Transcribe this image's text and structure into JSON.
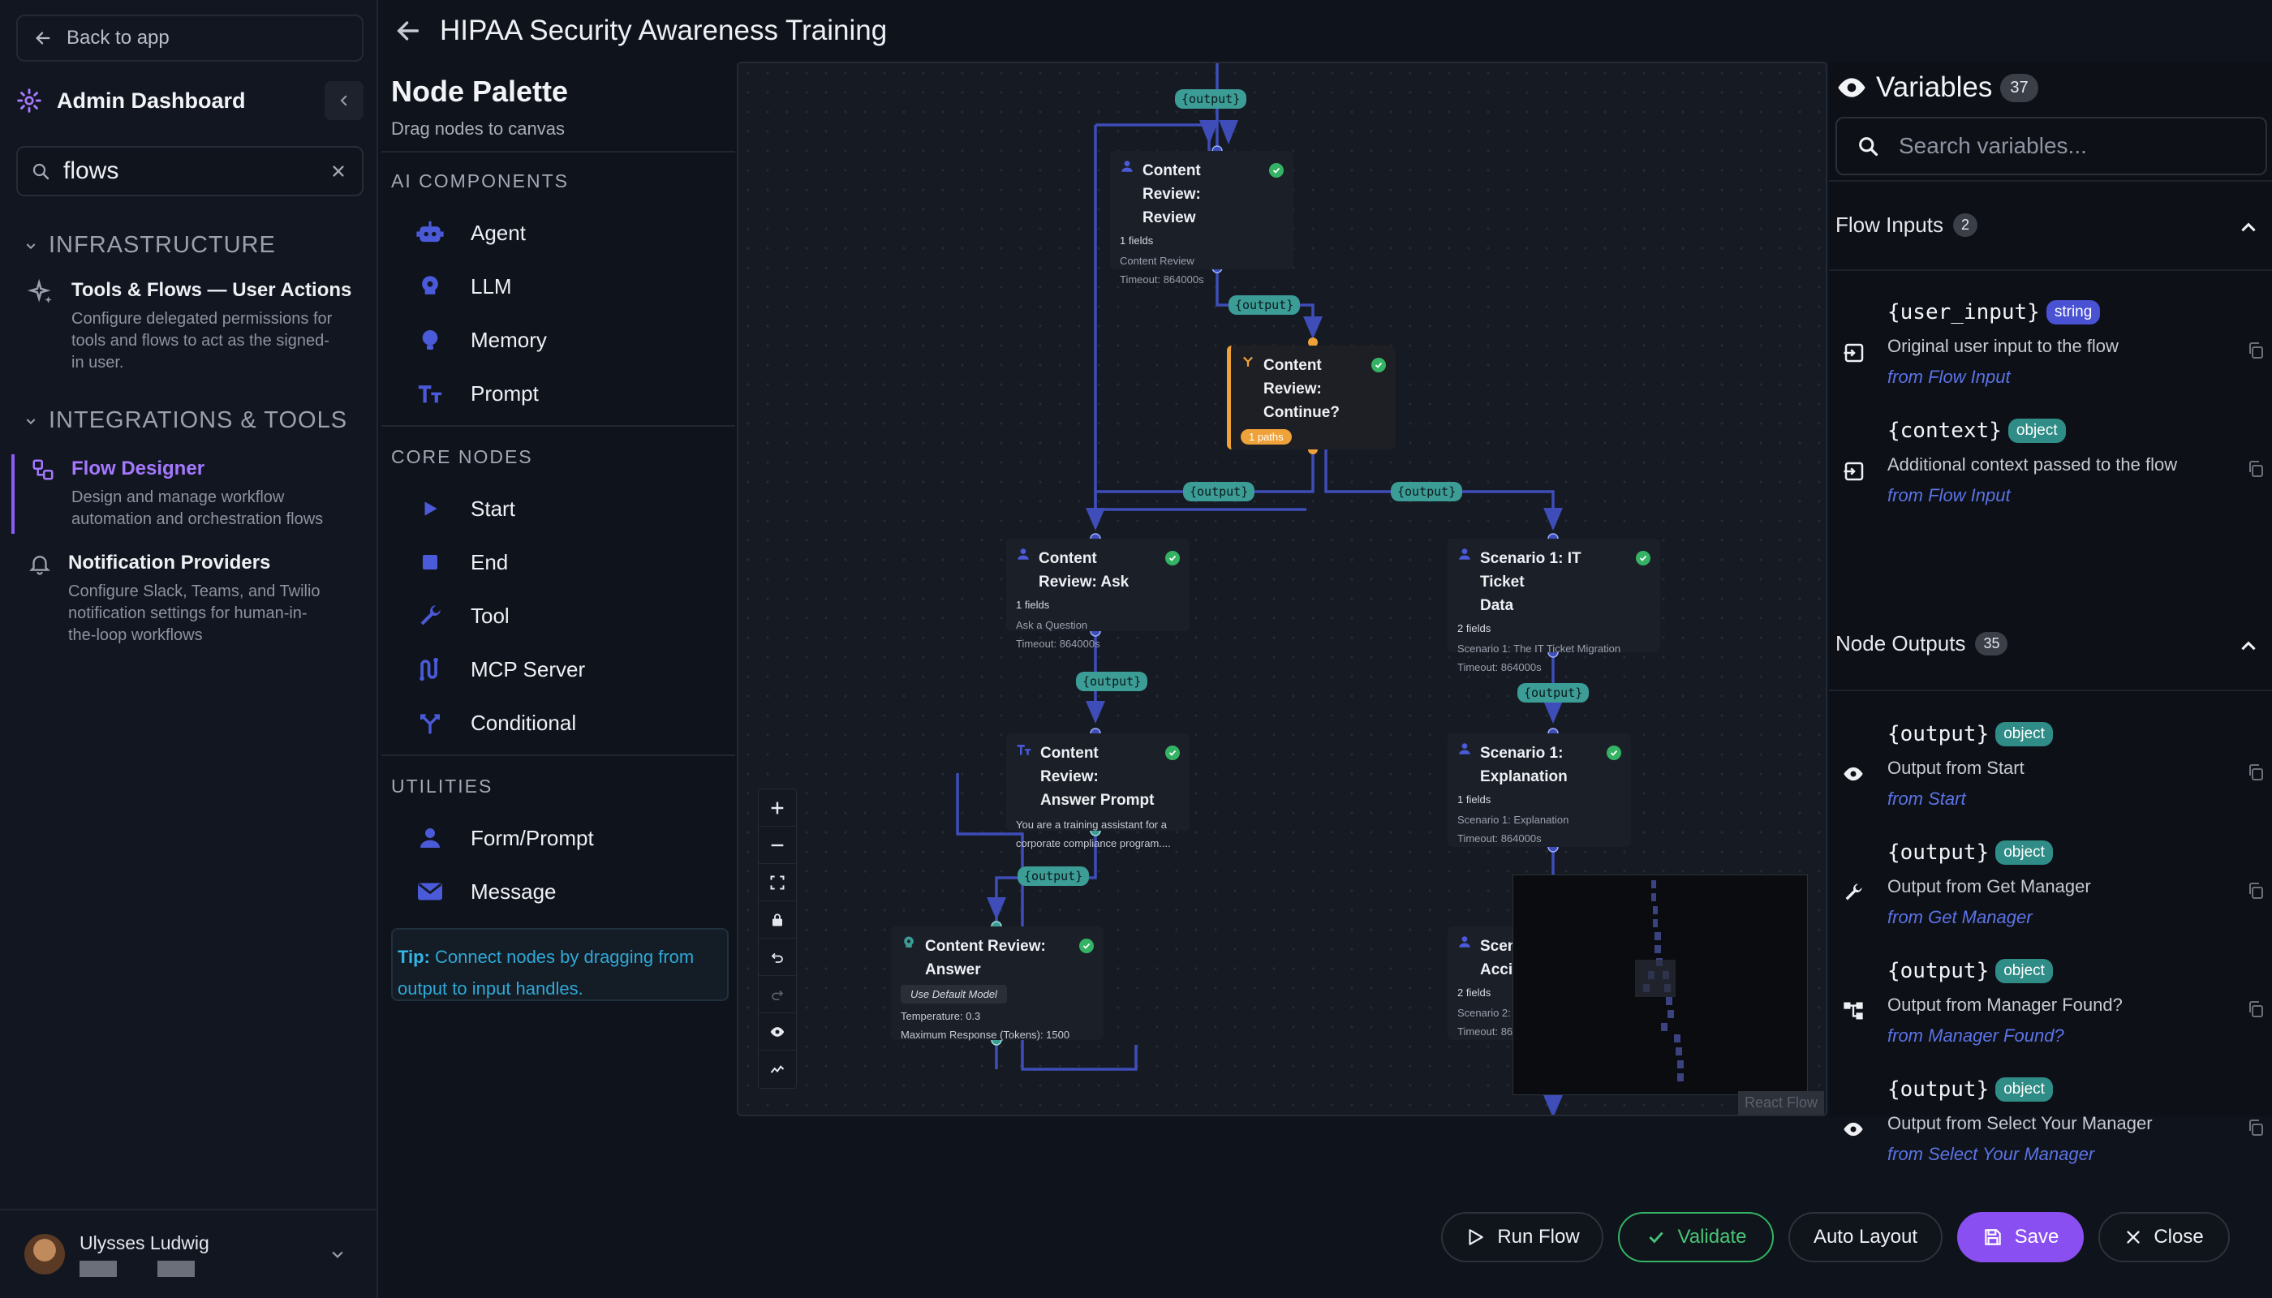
{
  "sidebar": {
    "back_label": "Back to app",
    "admin_title": "Admin Dashboard",
    "search_value": "flows",
    "sections": [
      {
        "title": "INFRASTRUCTURE"
      },
      {
        "title": "INTEGRATIONS & TOOLS"
      }
    ],
    "items": [
      {
        "title": "Tools & Flows — User Actions",
        "desc_lines": [
          "Configure delegated permissions for",
          "tools and flows to act as the signed-",
          "in user."
        ]
      },
      {
        "title": "Flow Designer",
        "desc_lines": [
          "Design and manage workflow",
          "automation and orchestration flows"
        ]
      },
      {
        "title": "Notification Providers",
        "desc_lines": [
          "Configure Slack, Teams, and Twilio",
          "notification settings for human-in-",
          "the-loop workflows"
        ]
      }
    ],
    "user_name": "Ulysses Ludwig"
  },
  "header": {
    "title": "HIPAA Security Awareness Training"
  },
  "palette": {
    "title": "Node Palette",
    "subtitle": "Drag nodes to canvas",
    "sections": [
      {
        "title": "AI COMPONENTS",
        "items": [
          {
            "label": "Agent",
            "icon": "robot-icon"
          },
          {
            "label": "LLM",
            "icon": "brain-icon"
          },
          {
            "label": "Memory",
            "icon": "bulb-icon"
          },
          {
            "label": "Prompt",
            "icon": "text-icon"
          }
        ]
      },
      {
        "title": "CORE NODES",
        "items": [
          {
            "label": "Start",
            "icon": "play-icon"
          },
          {
            "label": "End",
            "icon": "stop-icon"
          },
          {
            "label": "Tool",
            "icon": "wrench-icon"
          },
          {
            "label": "MCP Server",
            "icon": "mcp-icon"
          },
          {
            "label": "Conditional",
            "icon": "branch-icon"
          }
        ]
      },
      {
        "title": "UTILITIES",
        "items": [
          {
            "label": "Form/Prompt",
            "icon": "person-icon"
          },
          {
            "label": "Message",
            "icon": "mail-icon"
          }
        ]
      }
    ],
    "tip_label": "Tip:",
    "tip_lines": [
      "Connect nodes by dragging from",
      "output to input handles."
    ]
  },
  "canvas": {
    "edge_label": "{output}",
    "nodes": {
      "review": {
        "title_lines": [
          "Content Review:",
          "Review"
        ],
        "fields": "1 fields",
        "meta": [
          "Content Review",
          "Timeout: 864000s"
        ]
      },
      "continue": {
        "title_lines": [
          "Content",
          "Review:",
          "Continue?"
        ],
        "badge": "1 paths"
      },
      "ask": {
        "title_lines": [
          "Content Review: Ask"
        ],
        "fields": "1 fields",
        "meta": [
          "Ask a Question",
          "Timeout: 864000s"
        ]
      },
      "ticket": {
        "title_lines": [
          "Scenario 1: IT Ticket",
          "Data"
        ],
        "fields": "2 fields",
        "meta": [
          "Scenario 1: The IT Ticket Migration",
          "Timeout: 864000s"
        ]
      },
      "answer_prompt": {
        "title_lines": [
          "Content Review:",
          "Answer Prompt"
        ],
        "meta": [
          "You are a training assistant for a",
          "corporate compliance program...."
        ]
      },
      "explanation": {
        "title_lines": [
          "Scenario 1:",
          "Explanation"
        ],
        "fields": "1 fields",
        "meta": [
          "Scenario 1: Explanation",
          "Timeout: 864000s"
        ]
      },
      "answer": {
        "title_lines": [
          "Content Review:",
          "Answer"
        ],
        "model": "Use Default Model",
        "meta": [
          "Temperature: 0.3",
          "Maximum Response (Tokens): 1500"
        ]
      },
      "partial": {
        "title_lines": [
          "Scen",
          "Accid"
        ],
        "fields": "2 fields",
        "meta": [
          "Scenario 2:",
          "Timeout: 864"
        ]
      }
    },
    "attribution": "React Flow"
  },
  "variables": {
    "title": "Variables",
    "count": "37",
    "search_placeholder": "Search variables...",
    "groups": [
      {
        "title": "Flow Inputs",
        "count": "2",
        "items": [
          {
            "name": "{user_input}",
            "type": "string",
            "desc": "Original user input to the flow",
            "source": "from Flow Input",
            "icon": "input-icon"
          },
          {
            "name": "{context}",
            "type": "object",
            "desc": "Additional context passed to the flow",
            "source": "from Flow Input",
            "icon": "input-icon"
          }
        ]
      },
      {
        "title": "Node Outputs",
        "count": "35",
        "items": [
          {
            "name": "{output}",
            "type": "object",
            "desc": "Output from Start",
            "source": "from Start",
            "icon": "eye-icon"
          },
          {
            "name": "{output}",
            "type": "object",
            "desc": "Output from Get Manager",
            "source": "from Get Manager",
            "icon": "wrench-icon"
          },
          {
            "name": "{output}",
            "type": "object",
            "desc": "Output from Manager Found?",
            "source": "from Manager Found?",
            "icon": "branch-icon"
          },
          {
            "name": "{output}",
            "type": "object",
            "desc": "Output from Select Your Manager",
            "source": "from Select Your Manager",
            "icon": "eye-icon"
          }
        ]
      }
    ]
  },
  "toolbar": {
    "run": "Run Flow",
    "validate": "Validate",
    "auto_layout": "Auto Layout",
    "save": "Save",
    "close": "Close"
  },
  "colors": {
    "accent": "#8a4ff0",
    "edge": "#3e4db8",
    "edge_label": "#3c9c96",
    "success": "#34b364",
    "conditional": "#f0a23a",
    "string_badge": "#4a52d4",
    "object_badge": "#2f8c86"
  }
}
